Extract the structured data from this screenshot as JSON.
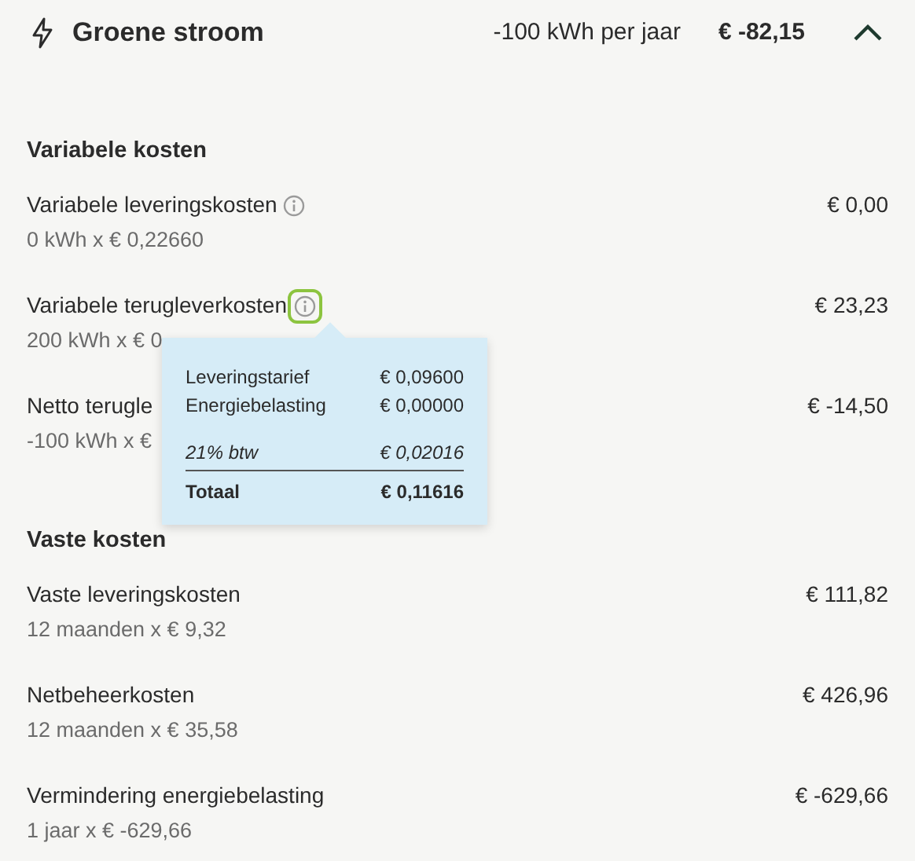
{
  "header": {
    "title": "Groene stroom",
    "usage": "-100 kWh per jaar",
    "total": "€ -82,15",
    "expanded": true
  },
  "sections": [
    {
      "title": "Variabele kosten",
      "rows": [
        {
          "label": "Variabele leveringskosten",
          "detail": "0 kWh x € 0,22660",
          "amount": "€ 0,00",
          "info": {
            "active": false
          }
        },
        {
          "label": "Variabele terugleverkosten",
          "detail": "200 kWh x € 0",
          "amount": "€ 23,23",
          "info": {
            "active": true
          }
        },
        {
          "label": "Netto terugle",
          "detail": "-100 kWh x €",
          "amount": "€ -14,50"
        }
      ]
    },
    {
      "title": "Vaste kosten",
      "rows": [
        {
          "label": "Vaste leveringskosten",
          "detail": "12 maanden x € 9,32",
          "amount": "€ 111,82"
        },
        {
          "label": "Netbeheerkosten",
          "detail": "12 maanden x € 35,58",
          "amount": "€ 426,96"
        },
        {
          "label": "Vermindering energiebelasting",
          "detail": "1 jaar x € -629,66",
          "amount": "€ -629,66"
        }
      ]
    }
  ],
  "tooltip": {
    "rows": [
      {
        "kind": "plain",
        "label": "Leveringstarief",
        "value": "€ 0,09600"
      },
      {
        "kind": "plain",
        "label": "Energiebelasting",
        "value": "€ 0,00000"
      },
      {
        "kind": "tax",
        "label": "21% btw",
        "value": "€ 0,02016"
      },
      {
        "kind": "total",
        "label": "Totaal",
        "value": "€ 0,11616"
      }
    ]
  }
}
